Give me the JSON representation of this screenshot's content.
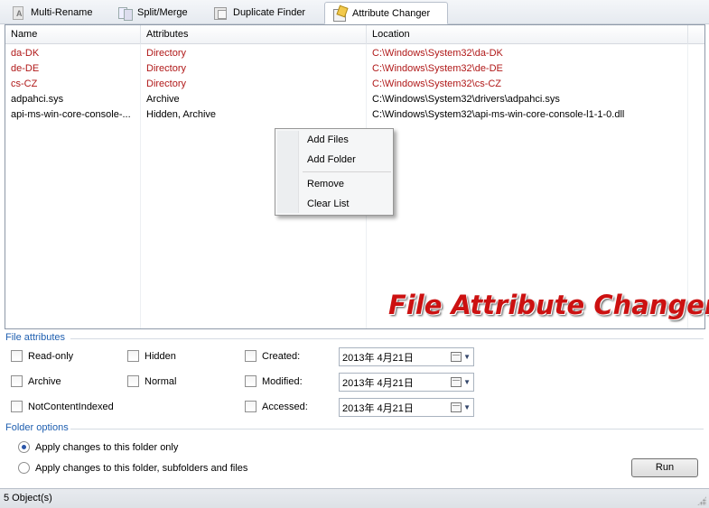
{
  "tabs": [
    {
      "label": "Multi-Rename",
      "icon": "rename-icon",
      "active": false
    },
    {
      "label": "Split/Merge",
      "icon": "split-merge-icon",
      "active": false
    },
    {
      "label": "Duplicate Finder",
      "icon": "duplicate-finder-icon",
      "active": false
    },
    {
      "label": "Attribute Changer",
      "icon": "attribute-changer-icon",
      "active": true
    }
  ],
  "list": {
    "columns": [
      "Name",
      "Attributes",
      "Location"
    ],
    "rows": [
      {
        "name": "da-DK",
        "attributes": "Directory",
        "location": "C:\\Windows\\System32\\da-DK",
        "is_directory": true
      },
      {
        "name": "de-DE",
        "attributes": "Directory",
        "location": "C:\\Windows\\System32\\de-DE",
        "is_directory": true
      },
      {
        "name": "cs-CZ",
        "attributes": "Directory",
        "location": "C:\\Windows\\System32\\cs-CZ",
        "is_directory": true
      },
      {
        "name": "adpahci.sys",
        "attributes": "Archive",
        "location": "C:\\Windows\\System32\\drivers\\adpahci.sys",
        "is_directory": false
      },
      {
        "name": "api-ms-win-core-console-...",
        "attributes": "Hidden, Archive",
        "location": "C:\\Windows\\System32\\api-ms-win-core-console-l1-1-0.dll",
        "is_directory": false
      }
    ],
    "watermark": "File Attribute Changer",
    "directory_color": "#b01818",
    "watermark_color": "#cc1111"
  },
  "context_menu": {
    "items": [
      "Add Files",
      "Add Folder",
      "Remove",
      "Clear List"
    ]
  },
  "file_attributes": {
    "label": "File attributes",
    "read_only": "Read-only",
    "hidden": "Hidden",
    "archive": "Archive",
    "normal": "Normal",
    "not_content_indexed": "NotContentIndexed",
    "created_label": "Created:",
    "modified_label": "Modified:",
    "accessed_label": "Accessed:",
    "created_value": "2013年  4月21日",
    "modified_value": "2013年  4月21日",
    "accessed_value": "2013年  4月21日"
  },
  "folder_options": {
    "label": "Folder options",
    "option_this_folder": "Apply changes to this folder only",
    "option_subfolders": "Apply changes to this folder, subfolders and files",
    "selected": "option_this_folder"
  },
  "run_label": "Run",
  "status": {
    "text": "5 Object(s)"
  }
}
